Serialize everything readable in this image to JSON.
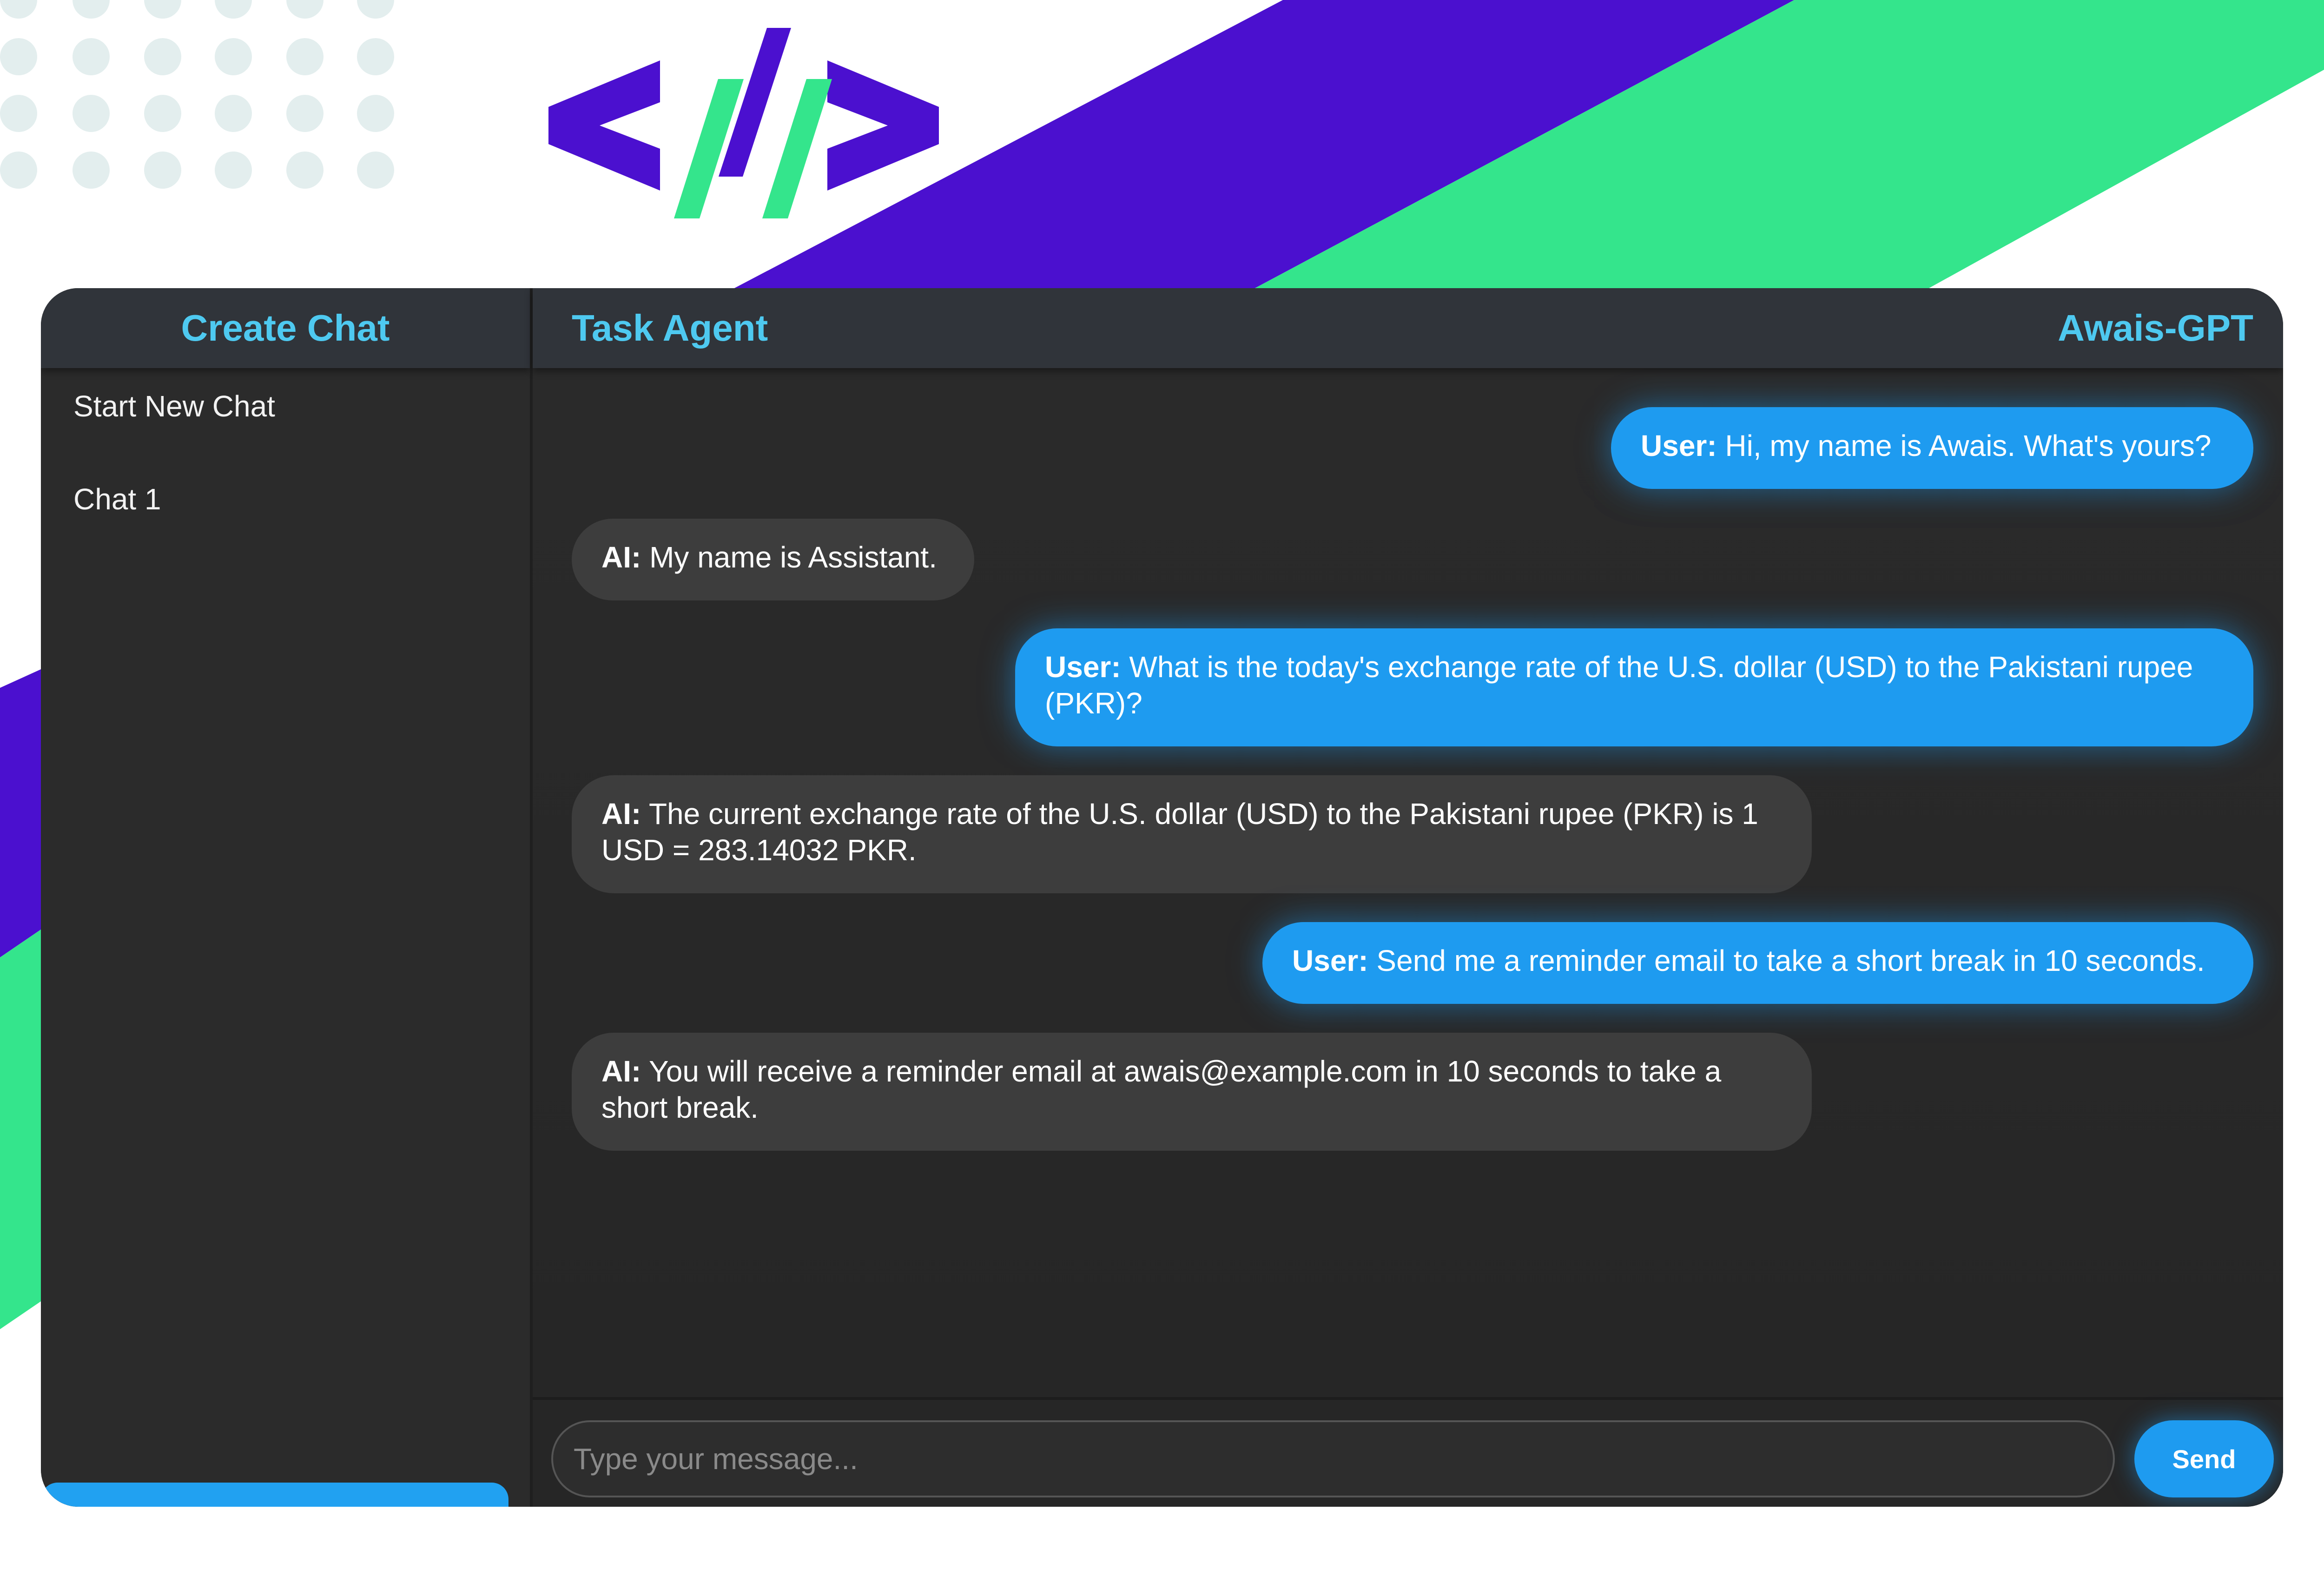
{
  "colors": {
    "purple": "#4b10cf",
    "green": "#34e58c",
    "accent_text": "#4ec9f0",
    "user_bubble": "#1e9bf0",
    "ai_bubble": "#3d3d3d"
  },
  "sidebar": {
    "title": "Create Chat",
    "items": [
      {
        "label": "Start New Chat"
      },
      {
        "label": "Chat 1"
      }
    ]
  },
  "header": {
    "title": "Task Agent",
    "brand": "Awais-GPT"
  },
  "messages": [
    {
      "role": "user",
      "speaker": "User:",
      "text": "Hi, my name is Awais. What's yours?"
    },
    {
      "role": "ai",
      "speaker": "AI:",
      "text": "My name is Assistant."
    },
    {
      "role": "user",
      "speaker": "User:",
      "text": "What is the today's exchange rate of the U.S. dollar (USD) to the Pakistani rupee (PKR)?"
    },
    {
      "role": "ai",
      "speaker": "AI:",
      "text": "The current exchange rate of the U.S. dollar (USD) to the Pakistani rupee (PKR) is 1 USD = 283.14032 PKR."
    },
    {
      "role": "user",
      "speaker": "User:",
      "text": "Send me a reminder email to take a short break in 10 seconds."
    },
    {
      "role": "ai",
      "speaker": "AI:",
      "text": "You will receive a reminder email at awais@example.com in 10 seconds to take a short break."
    }
  ],
  "composer": {
    "placeholder": "Type your message...",
    "send_label": "Send"
  },
  "icons": {
    "logo": "code-brackets-logo-icon"
  }
}
